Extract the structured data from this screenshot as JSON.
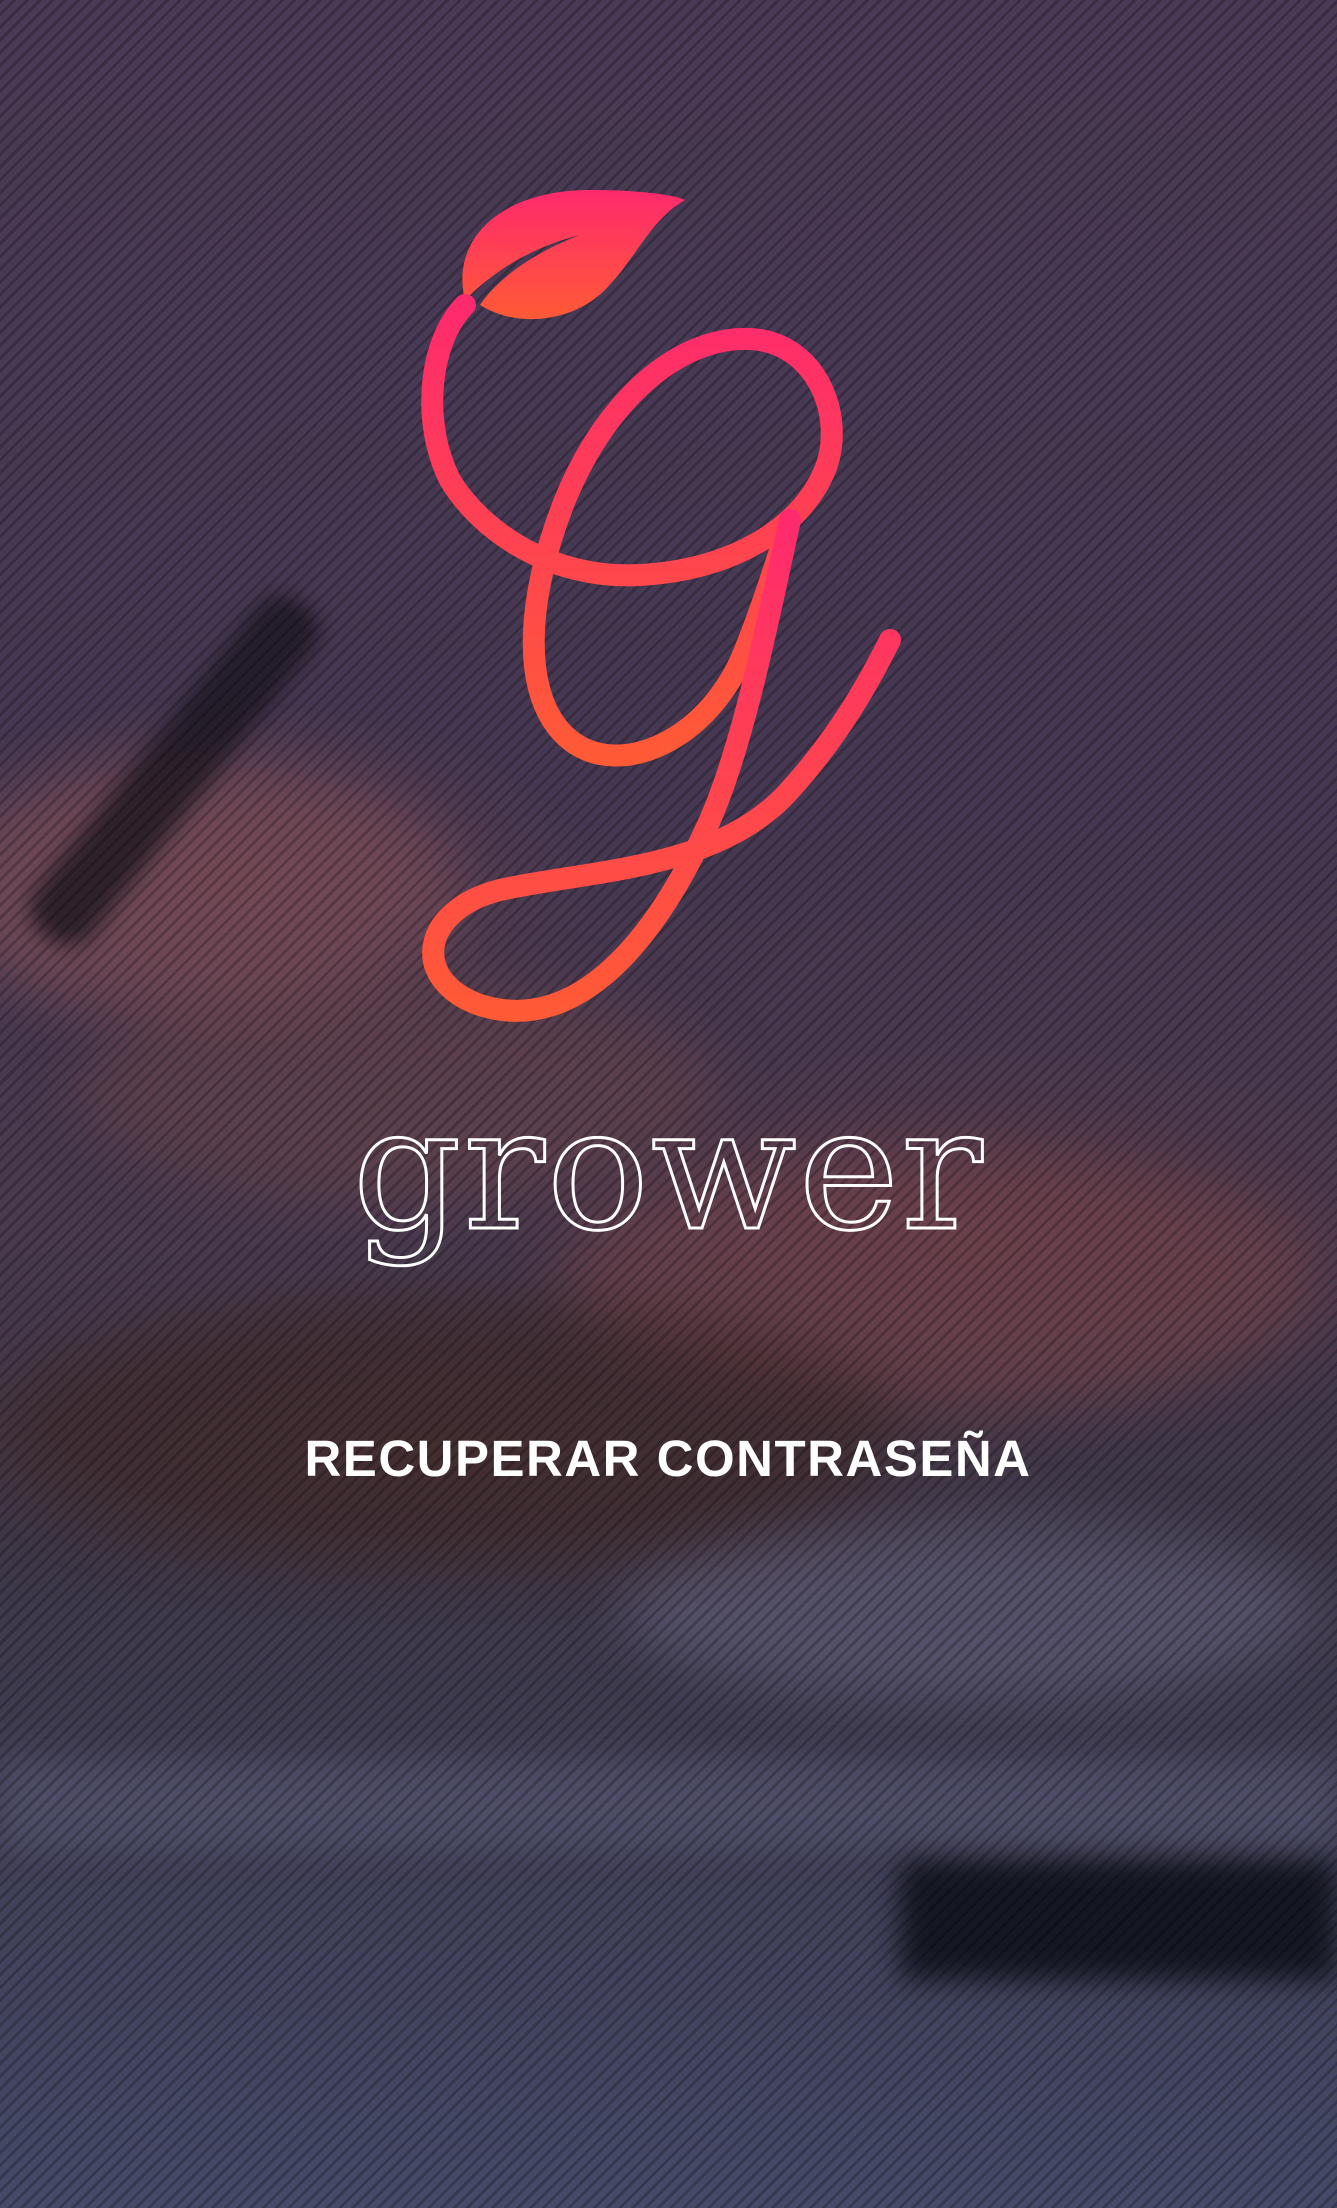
{
  "app": {
    "name": "grower"
  },
  "brand": {
    "gradient_top": "#ff2a6d",
    "gradient_bottom": "#ff5a36",
    "wordmark_color": "#ffffff",
    "logo_icon": "leaf-g-logo-icon"
  },
  "actions": {
    "recover_password_label": "RECUPERAR CONTRASEÑA"
  }
}
